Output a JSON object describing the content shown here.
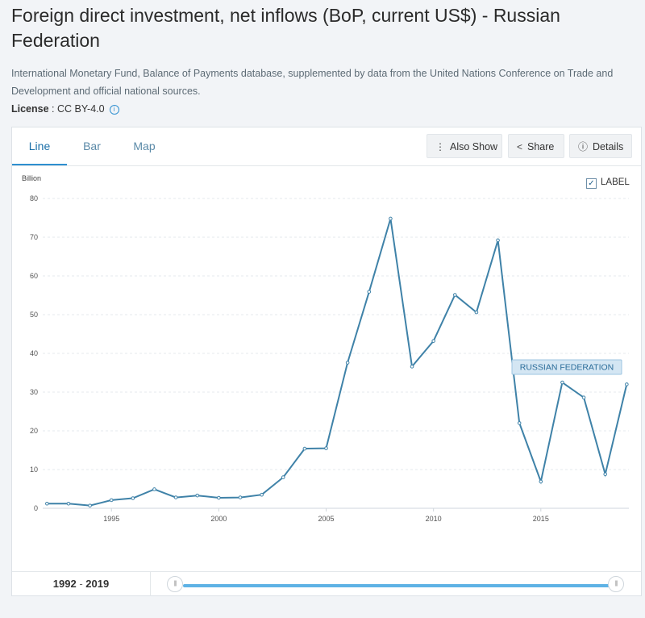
{
  "header": {
    "title": "Foreign direct investment, net inflows (BoP, current US$) - Russian Federation",
    "source": "International Monetary Fund, Balance of Payments database, supplemented by data from the United Nations Conference on Trade and Development and official national sources.",
    "license_label": "License",
    "license_sep": " : ",
    "license_value": "CC BY-4.0",
    "info_glyph": "i"
  },
  "tabs": [
    {
      "label": "Line",
      "active": true
    },
    {
      "label": "Bar",
      "active": false
    },
    {
      "label": "Map",
      "active": false
    }
  ],
  "toolbar": {
    "also_show": "Also Show",
    "share": "Share",
    "details": "Details",
    "also_show_icon": "more-vertical-icon",
    "share_icon": "share-icon",
    "details_icon": "info-circle-icon"
  },
  "label_toggle": {
    "text": "LABEL",
    "checked": true,
    "check_glyph": "✓"
  },
  "range": {
    "start": "1992",
    "sep": " - ",
    "end": "2019",
    "handle_glyph": "|||"
  },
  "colors": {
    "line": "#3f82a8",
    "accent": "#2f8fd0",
    "label_bg": "#d4e6f3"
  },
  "chart_data": {
    "type": "line",
    "unit_label": "Billion",
    "ylim": [
      0,
      80
    ],
    "yticks": [
      0,
      10,
      20,
      30,
      40,
      50,
      60,
      70,
      80
    ],
    "xticks": [
      1995,
      2000,
      2005,
      2010,
      2015
    ],
    "grid": true,
    "series": [
      {
        "name": "RUSSIAN FEDERATION",
        "x": [
          1992,
          1993,
          1994,
          1995,
          1996,
          1997,
          1998,
          1999,
          2000,
          2001,
          2002,
          2003,
          2004,
          2005,
          2006,
          2007,
          2008,
          2009,
          2010,
          2011,
          2012,
          2013,
          2014,
          2015,
          2016,
          2017,
          2018,
          2019
        ],
        "y": [
          1.2,
          1.2,
          0.7,
          2.1,
          2.6,
          4.9,
          2.8,
          3.3,
          2.7,
          2.8,
          3.5,
          8.0,
          15.4,
          15.5,
          37.6,
          55.9,
          74.8,
          36.6,
          43.2,
          55.1,
          50.6,
          69.2,
          22.0,
          6.9,
          32.5,
          28.6,
          8.8,
          32.0
        ]
      }
    ]
  }
}
